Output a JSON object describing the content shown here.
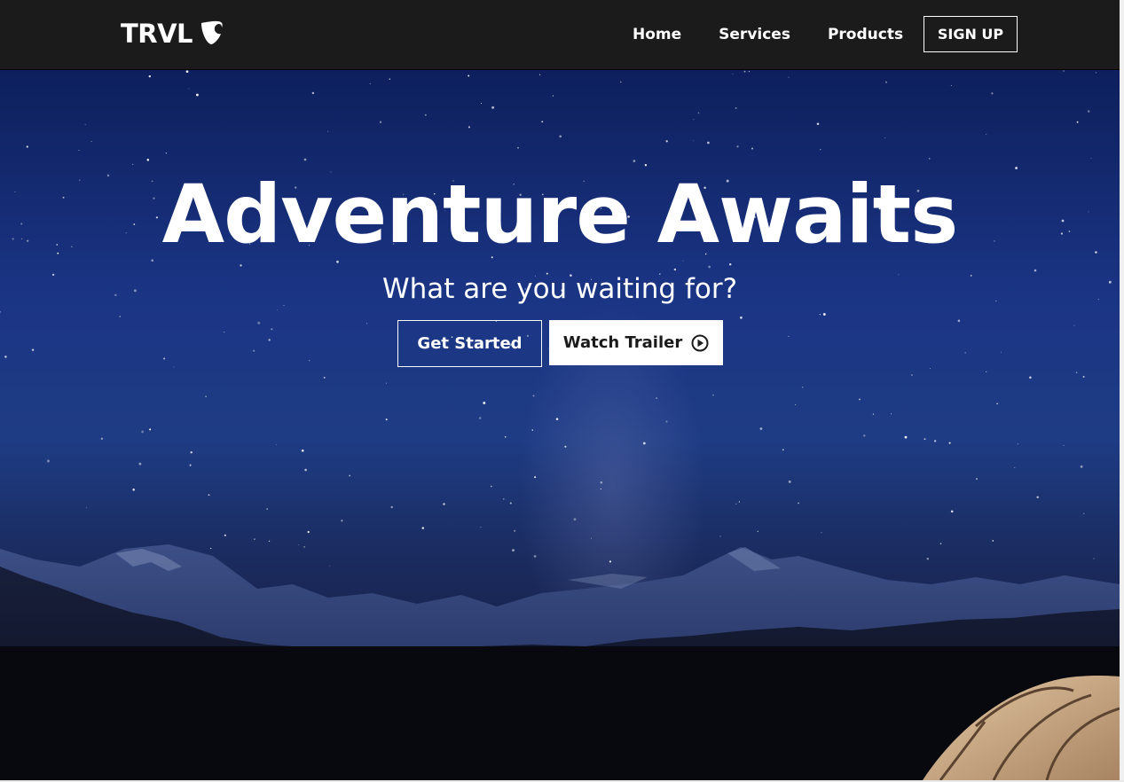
{
  "brand": {
    "name": "TRVL",
    "icon": "typo3-logo-icon"
  },
  "nav": {
    "items": [
      {
        "label": "Home"
      },
      {
        "label": "Services"
      },
      {
        "label": "Products"
      }
    ],
    "signup_label": "SIGN UP"
  },
  "hero": {
    "title": "Adventure Awaits",
    "subtitle": "What are you waiting for?",
    "primary_button": "Get Started",
    "secondary_button": "Watch Trailer",
    "secondary_button_icon": "play-circle-icon",
    "background": "night-sky-mountains-tent"
  },
  "colors": {
    "navbar": "#1c1b1b",
    "text": "#ffffff",
    "sky_top": "#0d1f5c",
    "sky_mid": "#1e3c84"
  }
}
